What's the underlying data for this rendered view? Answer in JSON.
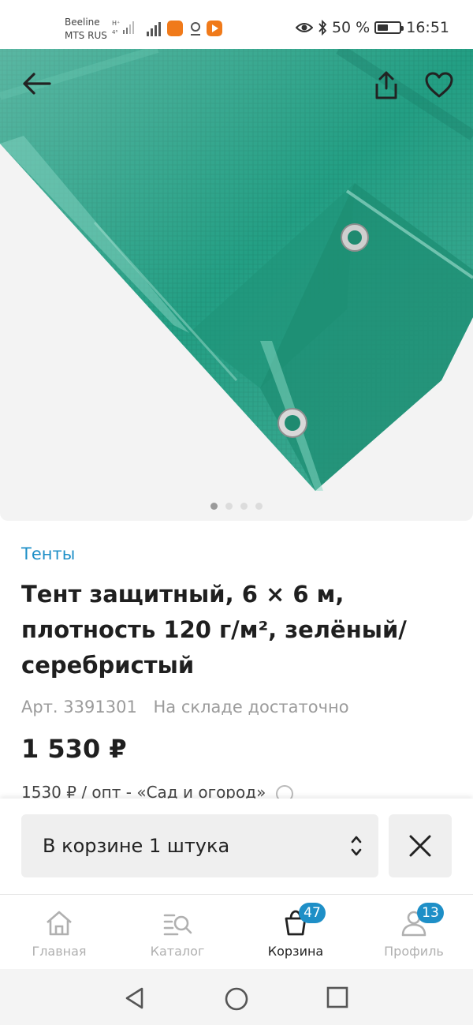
{
  "status": {
    "carrier_1": "Beeline",
    "carrier_2": "MTS RUS",
    "battery_percent": "50 %",
    "battery_level": 0.5,
    "time": "16:51"
  },
  "gallery": {
    "image_count": 4,
    "active_index": 0,
    "tarp_color": "#2aa085"
  },
  "product": {
    "category": "Тенты",
    "title": "Тент защитный, 6 × 6 м, плотность 120 г/м², зелёный/серебристый",
    "article": "Арт. 3391301",
    "stock": "На складе достаточно",
    "price": "1 530 ₽",
    "wholesale_note": "1530 ₽ / опт - «Сад и огород»"
  },
  "cart": {
    "quantity_label": "В корзине 1 штука"
  },
  "tabs": [
    {
      "label": "Главная",
      "icon": "home-icon"
    },
    {
      "label": "Каталог",
      "icon": "catalog-search-icon"
    },
    {
      "label": "Корзина",
      "icon": "cart-bag-icon",
      "badge": "47"
    },
    {
      "label": "Профиль",
      "icon": "profile-icon",
      "badge": "13"
    }
  ],
  "colors": {
    "accent": "#1e8fc7",
    "text": "#1f1f1f",
    "muted": "#9b9b9b"
  }
}
